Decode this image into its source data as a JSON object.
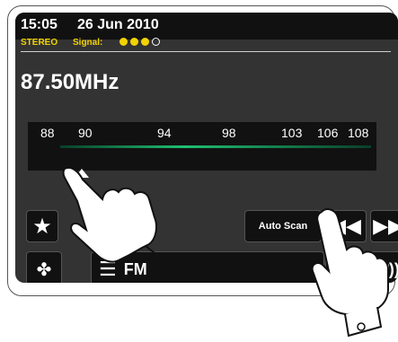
{
  "status": {
    "time": "15:05",
    "date": "26 Jun 2010",
    "stereo_label": "STEREO",
    "signal_label": "Signal:",
    "signal_strength": 3,
    "signal_max": 4
  },
  "tuner": {
    "frequency": "87.50MHz",
    "scale_ticks": [
      "88",
      "90",
      "94",
      "98",
      "103",
      "106",
      "108"
    ]
  },
  "controls": {
    "favorites_icon": "star-icon",
    "auto_scan_label": "Auto Scan",
    "rewind_icon": "rewind-icon",
    "fast_forward_icon": "fast-forward-icon"
  },
  "bottom": {
    "apps_icon": "apps-grid-icon",
    "menu_icon": "menu-icon",
    "source_label": "FM",
    "volume_icon": "volume-icon"
  },
  "colors": {
    "status_text": "#f2d300",
    "screen_bg": "#333333",
    "scale_line": "#1fbf71"
  }
}
